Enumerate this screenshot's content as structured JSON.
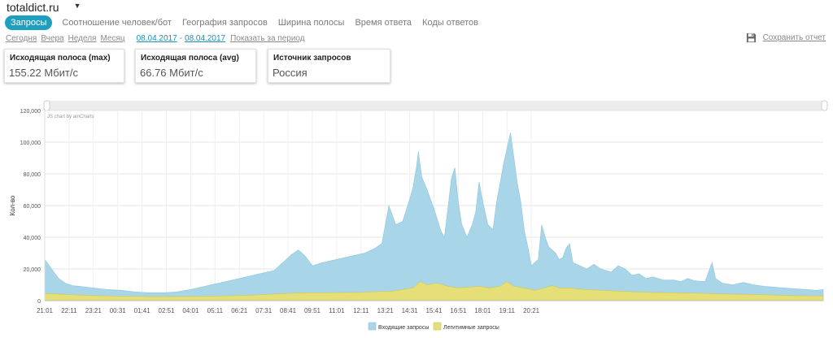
{
  "site": {
    "name": "totaldict.ru",
    "caret": "▼"
  },
  "tabs": [
    {
      "label": "Запросы",
      "active": true
    },
    {
      "label": "Соотношение человек/бот",
      "active": false
    },
    {
      "label": "География запросов",
      "active": false
    },
    {
      "label": "Ширина полосы",
      "active": false
    },
    {
      "label": "Время ответа",
      "active": false
    },
    {
      "label": "Коды ответов",
      "active": false
    }
  ],
  "periods": {
    "today": "Сегодня",
    "yesterday": "Вчера",
    "week": "Неделя",
    "month": "Месяц"
  },
  "date_range": {
    "from": "08.04.2017",
    "separator": "-",
    "to": "08.04.2017",
    "show_label": "Показать за период"
  },
  "save": {
    "label": "Сохранить отчет",
    "icon": "floppy-disk-icon"
  },
  "cards": [
    {
      "title": "Исходящая полоса (max)",
      "value": "155.22 Мбит/с"
    },
    {
      "title": "Исходящая полоса (avg)",
      "value": "66.76 Мбит/с"
    },
    {
      "title": "Источник запросов",
      "value": "Россия"
    }
  ],
  "colors": {
    "accent": "#1da0c0",
    "incoming": "#a8d5e8",
    "legit": "#e6df78"
  },
  "chart_watermark": "JS chart by amCharts",
  "chart_data": {
    "type": "area",
    "stacked": false,
    "ylabel": "Кол-во",
    "xlabel": "",
    "ylim": [
      0,
      120000
    ],
    "yticks": [
      0,
      20000,
      40000,
      60000,
      80000,
      100000,
      120000
    ],
    "ytick_labels": [
      "0",
      "20,000",
      "40,000",
      "60,000",
      "80,000",
      "100,000",
      "120,000"
    ],
    "xtick_labels": [
      "21:01",
      "22:11",
      "23:21",
      "00:31",
      "01:41",
      "02:51",
      "04:01",
      "05:11",
      "06:21",
      "07:31",
      "08:41",
      "09:51",
      "11:01",
      "12:11",
      "13:21",
      "14:31",
      "15:41",
      "16:51",
      "18:01",
      "19:11",
      "20:21"
    ],
    "grid": true,
    "legend_position": "bottom",
    "x_start_minutes": 1261,
    "x_step_minutes": 5,
    "series": [
      {
        "name": "Входящие запросы",
        "color": "#a8d5e8",
        "points": [
          [
            0,
            26000
          ],
          [
            4,
            20000
          ],
          [
            8,
            14000
          ],
          [
            12,
            11000
          ],
          [
            16,
            9500
          ],
          [
            20,
            9000
          ],
          [
            28,
            8000
          ],
          [
            36,
            7000
          ],
          [
            44,
            6500
          ],
          [
            52,
            5500
          ],
          [
            60,
            5000
          ],
          [
            68,
            5000
          ],
          [
            76,
            5500
          ],
          [
            84,
            7000
          ],
          [
            92,
            9000
          ],
          [
            100,
            11000
          ],
          [
            108,
            13000
          ],
          [
            116,
            15000
          ],
          [
            124,
            17000
          ],
          [
            132,
            19000
          ],
          [
            138,
            25000
          ],
          [
            142,
            29000
          ],
          [
            146,
            32000
          ],
          [
            150,
            28000
          ],
          [
            154,
            22000
          ],
          [
            160,
            24000
          ],
          [
            168,
            26000
          ],
          [
            176,
            28000
          ],
          [
            184,
            30000
          ],
          [
            190,
            33000
          ],
          [
            194,
            36000
          ],
          [
            198,
            60000
          ],
          [
            202,
            48000
          ],
          [
            206,
            50000
          ],
          [
            210,
            64000
          ],
          [
            212,
            72000
          ],
          [
            214,
            85000
          ],
          [
            215,
            94000
          ],
          [
            217,
            78000
          ],
          [
            220,
            70000
          ],
          [
            224,
            58000
          ],
          [
            228,
            44000
          ],
          [
            230,
            40000
          ],
          [
            232,
            58000
          ],
          [
            234,
            77000
          ],
          [
            236,
            84000
          ],
          [
            238,
            62000
          ],
          [
            240,
            48000
          ],
          [
            243,
            40000
          ],
          [
            246,
            48000
          ],
          [
            248,
            56000
          ],
          [
            250,
            75000
          ],
          [
            252,
            63000
          ],
          [
            255,
            48000
          ],
          [
            258,
            45000
          ],
          [
            260,
            62000
          ],
          [
            262,
            74000
          ],
          [
            264,
            86000
          ],
          [
            266,
            96000
          ],
          [
            268,
            106000
          ],
          [
            270,
            90000
          ],
          [
            272,
            74000
          ],
          [
            274,
            62000
          ],
          [
            276,
            44000
          ],
          [
            278,
            34000
          ],
          [
            280,
            22000
          ],
          [
            284,
            26000
          ],
          [
            286,
            48000
          ],
          [
            288,
            40000
          ],
          [
            290,
            34000
          ],
          [
            294,
            30000
          ],
          [
            296,
            26000
          ],
          [
            298,
            27000
          ],
          [
            300,
            33000
          ],
          [
            302,
            36000
          ],
          [
            304,
            24000
          ],
          [
            308,
            22000
          ],
          [
            312,
            20000
          ],
          [
            316,
            23000
          ],
          [
            320,
            20000
          ],
          [
            326,
            18000
          ],
          [
            330,
            22000
          ],
          [
            334,
            20000
          ],
          [
            338,
            16000
          ],
          [
            342,
            17000
          ],
          [
            346,
            14000
          ],
          [
            350,
            15000
          ],
          [
            356,
            13000
          ],
          [
            362,
            13000
          ],
          [
            366,
            12000
          ],
          [
            370,
            14000
          ],
          [
            374,
            12500
          ],
          [
            380,
            12000
          ],
          [
            384,
            24000
          ],
          [
            386,
            14000
          ],
          [
            390,
            11000
          ],
          [
            396,
            10000
          ],
          [
            402,
            11500
          ],
          [
            408,
            10000
          ],
          [
            414,
            9000
          ],
          [
            420,
            8500
          ],
          [
            426,
            8000
          ],
          [
            432,
            7500
          ],
          [
            438,
            7000
          ],
          [
            444,
            6500
          ],
          [
            448,
            7000
          ]
        ]
      },
      {
        "name": "Легитимные запросы",
        "color": "#e6df78",
        "points": [
          [
            0,
            4500
          ],
          [
            20,
            3500
          ],
          [
            40,
            2800
          ],
          [
            60,
            2500
          ],
          [
            80,
            2500
          ],
          [
            100,
            2800
          ],
          [
            120,
            3500
          ],
          [
            140,
            4500
          ],
          [
            150,
            5000
          ],
          [
            160,
            5000
          ],
          [
            180,
            5200
          ],
          [
            200,
            6000
          ],
          [
            212,
            8000
          ],
          [
            216,
            12000
          ],
          [
            220,
            10000
          ],
          [
            226,
            11000
          ],
          [
            232,
            9000
          ],
          [
            238,
            8000
          ],
          [
            244,
            8500
          ],
          [
            250,
            9000
          ],
          [
            256,
            8000
          ],
          [
            262,
            9000
          ],
          [
            266,
            12000
          ],
          [
            270,
            9000
          ],
          [
            276,
            8000
          ],
          [
            282,
            6500
          ],
          [
            288,
            8000
          ],
          [
            292,
            9500
          ],
          [
            296,
            8000
          ],
          [
            302,
            8000
          ],
          [
            310,
            7000
          ],
          [
            320,
            6500
          ],
          [
            330,
            6000
          ],
          [
            340,
            5500
          ],
          [
            350,
            5200
          ],
          [
            360,
            5000
          ],
          [
            370,
            4800
          ],
          [
            380,
            4500
          ],
          [
            390,
            4200
          ],
          [
            400,
            4000
          ],
          [
            410,
            3800
          ],
          [
            420,
            3500
          ],
          [
            430,
            3200
          ],
          [
            440,
            3000
          ],
          [
            448,
            3000
          ]
        ]
      }
    ]
  }
}
